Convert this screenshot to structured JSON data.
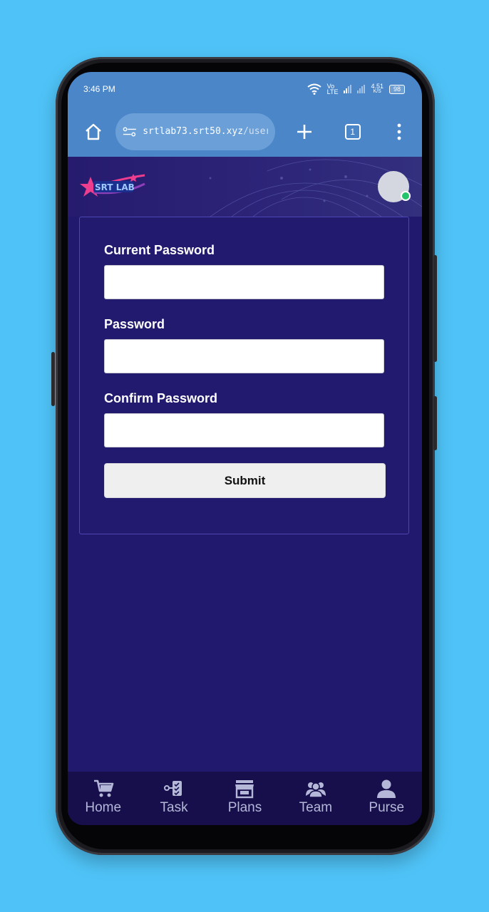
{
  "status_bar": {
    "time": "3:46 PM",
    "network_top": "Vo",
    "network_bottom": "LTE",
    "speed_top": "4.51",
    "speed_bottom": "K/S",
    "battery": "98"
  },
  "browser": {
    "url_host": "srtlab73.srt50.xyz",
    "url_path": "/user/c",
    "tab_count": "1"
  },
  "header": {
    "logo_text": "SRT LAB"
  },
  "form": {
    "current_password_label": "Current Password",
    "current_password_value": "",
    "password_label": "Password",
    "password_value": "",
    "confirm_password_label": "Confirm Password",
    "confirm_password_value": "",
    "submit_label": "Submit"
  },
  "bottom_nav": {
    "items": [
      {
        "label": "Home",
        "icon": "cart-icon"
      },
      {
        "label": "Task",
        "icon": "task-icon"
      },
      {
        "label": "Plans",
        "icon": "store-icon"
      },
      {
        "label": "Team",
        "icon": "users-icon"
      },
      {
        "label": "Purse",
        "icon": "user-icon"
      }
    ]
  },
  "colors": {
    "page_bg": "#4fc3f7",
    "browser_bar": "#4b86c9",
    "content_bg": "#21196d",
    "nav_bg": "#160f4b",
    "online": "#25c36a"
  }
}
